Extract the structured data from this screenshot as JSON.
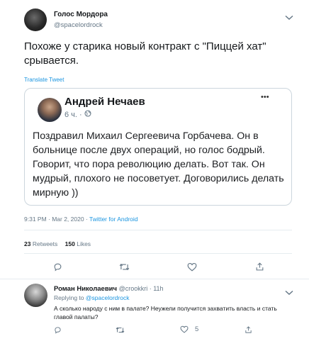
{
  "tweet": {
    "author_name": "Голос Мордора",
    "author_handle": "@spacelordrock",
    "text": "Похоже у старика новый контракт с \"Пиццей хат\" срывается.",
    "translate_label": "Translate Tweet",
    "timestamp": "9:31 PM · Mar 2, 2020",
    "client": "Twitter for Android",
    "client_sep": " · ",
    "retweets_count": "23",
    "retweets_label": "Retweets",
    "likes_count": "150",
    "likes_label": "Likes"
  },
  "embedded_post": {
    "author_name": "Андрей Нечаев",
    "time": "6 ч. ·",
    "more_label": "•••",
    "text": "Поздравил Михаил Сергеевича Горбачева. Он в больнице после двух операций, но голос бодрый. Говорит, что пора революцию делать. Вот так. Он мудрый, плохого не посоветует. Договорились делать мирную ))"
  },
  "reply": {
    "author_name": "Роман Николаевич",
    "author_handle": "@crookkri",
    "time": "· 11h",
    "replying_prefix": "Replying to",
    "replying_to": "@spacelordrock",
    "text": "А сколько народу с ним в палате? Неужели получится захватить власть и стать главой палаты?",
    "likes_count": "5"
  },
  "icons": {
    "chevron": "chevron-down-icon",
    "globe": "globe-icon",
    "reply": "reply-icon",
    "retweet": "retweet-icon",
    "like": "heart-icon",
    "share": "share-icon"
  },
  "colors": {
    "link_blue": "#1b95e0",
    "secondary_text": "#657786",
    "border": "#e6ecf0"
  }
}
